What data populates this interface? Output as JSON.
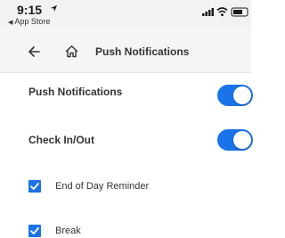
{
  "status_bar": {
    "time": "9:15",
    "back_app_label": "App Store",
    "back_app_glyph": "◀"
  },
  "header": {
    "title": "Push Notifications"
  },
  "settings": {
    "push_notifications": {
      "label": "Push Notifications",
      "enabled": true
    },
    "check_in_out": {
      "label": "Check In/Out",
      "enabled": true
    },
    "reminders": [
      {
        "label": "End of Day Reminder",
        "checked": true
      },
      {
        "label": "Break",
        "checked": true
      }
    ]
  },
  "colors": {
    "accent": "#1a73e8",
    "status_bar_bg": "#f2f2f2",
    "header_bg": "#f5f5f5"
  },
  "icons": {
    "location": "location-arrow-icon",
    "signal": "cellular-signal-icon",
    "wifi": "wifi-icon",
    "battery": "battery-icon",
    "back": "back-arrow-icon",
    "home": "home-icon",
    "check": "check-icon"
  }
}
